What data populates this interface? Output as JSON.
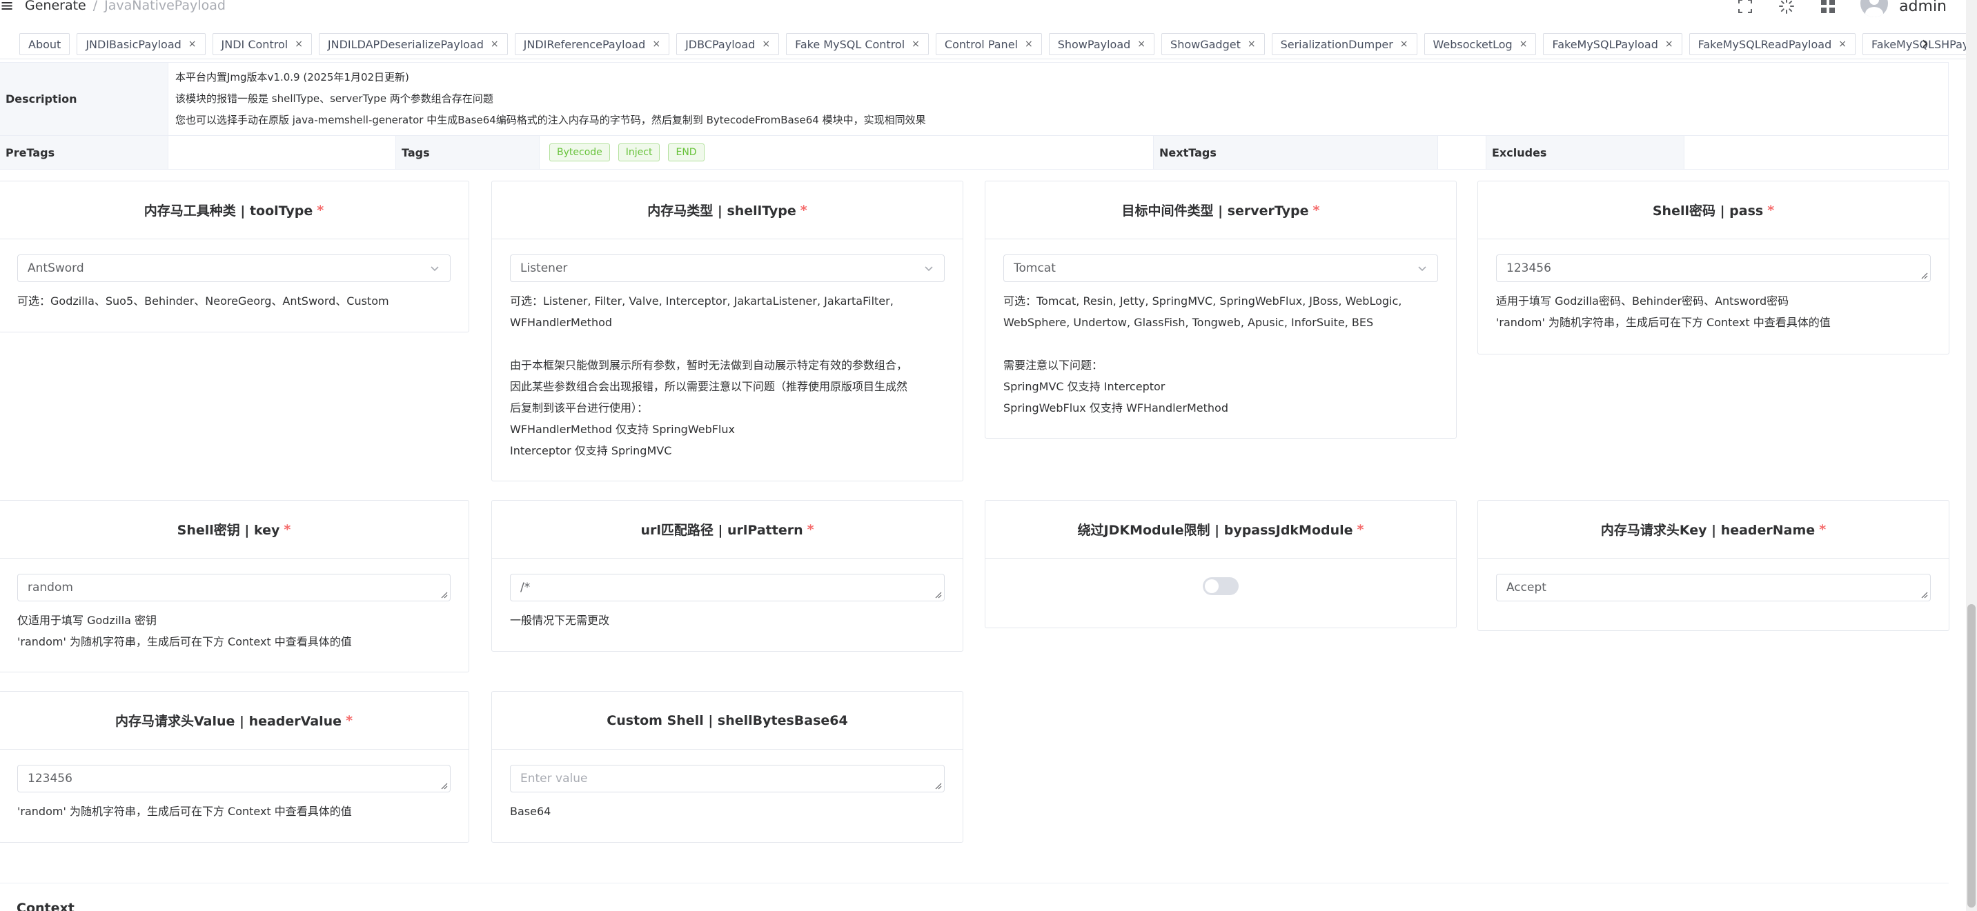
{
  "header": {
    "breadcrumb": [
      "Generate",
      "JavaNativePayload"
    ],
    "separator": "/",
    "user": "admin",
    "icons": [
      "fullscreen-icon",
      "theme-loader-icon",
      "grid-apps-icon",
      "avatar-icon"
    ]
  },
  "tabs": [
    {
      "label": "About",
      "closable": false
    },
    {
      "label": "JNDIBasicPayload",
      "closable": true
    },
    {
      "label": "JNDI Control",
      "closable": true
    },
    {
      "label": "JNDILDAPDeserializePayload",
      "closable": true
    },
    {
      "label": "JNDIReferencePayload",
      "closable": true
    },
    {
      "label": "JDBCPayload",
      "closable": true
    },
    {
      "label": "Fake MySQL Control",
      "closable": true
    },
    {
      "label": "Control Panel",
      "closable": true
    },
    {
      "label": "ShowPayload",
      "closable": true
    },
    {
      "label": "ShowGadget",
      "closable": true
    },
    {
      "label": "SerializationDumper",
      "closable": true
    },
    {
      "label": "WebsocketLog",
      "closable": true
    },
    {
      "label": "FakeMySQLPayload",
      "closable": true
    },
    {
      "label": "FakeMySQLReadPayload",
      "closable": true
    },
    {
      "label": "FakeMySQLSHPayload",
      "closable": true
    }
  ],
  "description": {
    "label": "Description",
    "lines": [
      "本平台内置Jmg版本v1.0.9 (2025年1月02日更新)",
      "该模块的报错一般是 shellType、serverType 两个参数组合存在问题",
      "您也可以选择手动在原版 java-memshell-generator 中生成Base64编码格式的注入内存马的字节码，然后复制到 BytecodeFromBase64 模块中，实现相同效果"
    ]
  },
  "tags_row": {
    "pretags_label": "PreTags",
    "tags_label": "Tags",
    "tags": [
      "Bytecode",
      "Inject",
      "END"
    ],
    "nexttags_label": "NextTags",
    "excludes_label": "Excludes"
  },
  "cards": [
    {
      "title": "内存马工具种类 | toolType",
      "required": "*",
      "type": "select",
      "value": "AntSword",
      "placeholder": "",
      "help": "可选：Godzilla、Suo5、Behinder、NeoreGeorg、AntSword、Custom"
    },
    {
      "title": "内存马类型 | shellType",
      "required": "*",
      "type": "select",
      "value": "Listener",
      "placeholder": "",
      "help": "可选：Listener, Filter, Valve, Interceptor, JakartaListener, JakartaFilter,\nWFHandlerMethod\n\n由于本框架只能做到展示所有参数，暂时无法做到自动展示特定有效的参数组合，\n因此某些参数组合会出现报错，所以需要注意以下问题（推荐使用原版项目生成然\n后复制到该平台进行使用）：\nWFHandlerMethod 仅支持 SpringWebFlux\nInterceptor 仅支持 SpringMVC"
    },
    {
      "title": "目标中间件类型 | serverType",
      "required": "*",
      "type": "select",
      "value": "Tomcat",
      "placeholder": "",
      "help": "可选：Tomcat, Resin, Jetty, SpringMVC, SpringWebFlux, JBoss, WebLogic,\nWebSphere, Undertow, GlassFish, Tongweb, Apusic, InforSuite, BES\n\n需要注意以下问题：\nSpringMVC 仅支持 Interceptor\nSpringWebFlux 仅支持 WFHandlerMethod"
    },
    {
      "title": "Shell密码 | pass",
      "required": "*",
      "type": "textarea",
      "value": "123456",
      "placeholder": "",
      "help": "适用于填写 Godzilla密码、Behinder密码、Antsword密码\n'random' 为随机字符串，生成后可在下方 Context 中查看具体的值"
    },
    {
      "title": "Shell密钥 | key",
      "required": "*",
      "type": "textarea",
      "value": "random",
      "placeholder": "",
      "help": "仅适用于填写 Godzilla 密钥\n'random' 为随机字符串，生成后可在下方 Context 中查看具体的值"
    },
    {
      "title": "url匹配路径 | urlPattern",
      "required": "*",
      "type": "textarea",
      "value": "/*",
      "placeholder": "",
      "help": "一般情况下无需更改"
    },
    {
      "title": "绕过JDKModule限制 | bypassJdkModule",
      "required": "*",
      "type": "switch",
      "value": "",
      "placeholder": "",
      "help": "",
      "switch_on": false
    },
    {
      "title": "内存马请求头Key | headerName",
      "required": "*",
      "type": "textarea",
      "value": "Accept",
      "placeholder": "",
      "help": ""
    },
    {
      "title": "内存马请求头Value | headerValue",
      "required": "*",
      "type": "textarea",
      "value": "123456",
      "placeholder": "",
      "help": "'random' 为随机字符串，生成后可在下方 Context 中查看具体的值"
    },
    {
      "title": "Custom Shell | shellBytesBase64",
      "required": "",
      "type": "textarea",
      "value": "",
      "placeholder": "Enter value",
      "help": "Base64"
    }
  ],
  "context": {
    "title": "Context"
  },
  "colors": {
    "required": "#f56c6c",
    "tag_text": "#67c23a",
    "tag_border": "#b3e19d",
    "tag_bg": "#f0f9eb"
  }
}
